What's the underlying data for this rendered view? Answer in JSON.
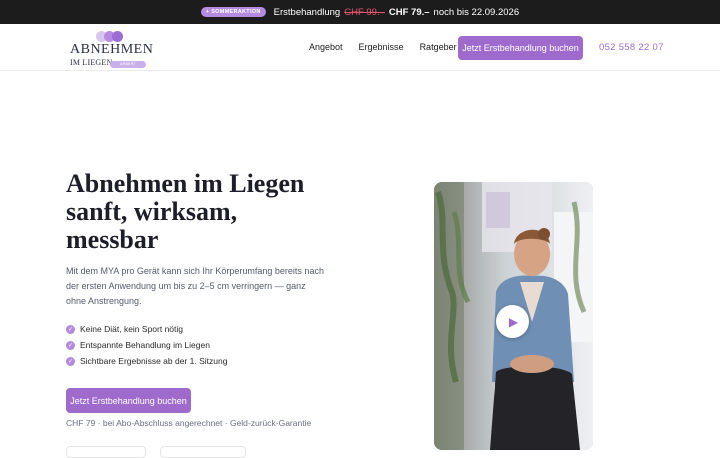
{
  "promo": {
    "badge": "+ SOMMERAKTION",
    "offer_label": "Erstbehandlung",
    "old_price": "CHF 99.–",
    "new_price": "CHF 79.–",
    "until": "noch bis 22.09.2026"
  },
  "header": {
    "logo_brand": "ABNEHMEN",
    "logo_sub": "IM LIEGEN",
    "logo_tag": "ARBERT",
    "nav": [
      "Angebot",
      "Ergebnisse",
      "Ratgeber"
    ],
    "cta_label": "Jetzt Erstbehandlung buchen",
    "phone": "052 558 22 07"
  },
  "hero": {
    "title_lines": [
      "Abnehmen im Liegen",
      "sanft, wirksam,",
      "messbar"
    ],
    "text": "Mit dem MYA pro Gerät kann sich Ihr Körperumfang bereits nach der ersten Anwendung um bis zu 2–5 cm verringern — ganz ohne Anstrengung.",
    "checks": [
      "Keine Diät, kein Sport nötig",
      "Entspannte Behandlung im Liegen",
      "Sichtbare Ergebnisse ab der 1. Sitzung"
    ],
    "cta_label": "Jetzt Erstbehandlung buchen",
    "price_note": "CHF 79 · bei Abo-Abschluss angerechnet · Geld-zurück-Garantie"
  },
  "video": {
    "play_icon": "play-icon"
  },
  "colors": {
    "accent": "#9e6bcd",
    "badge": "#b48be0",
    "dark_bar": "#1c1c1c",
    "old_price": "#e0556a"
  }
}
